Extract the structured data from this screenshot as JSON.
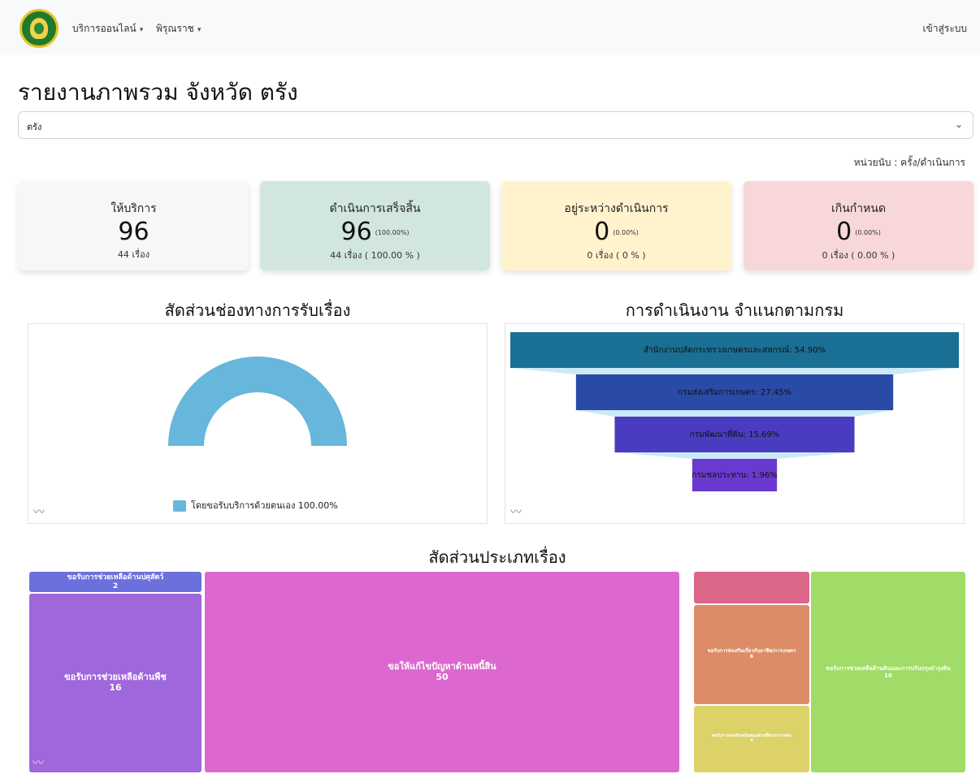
{
  "nav": {
    "online_services": "บริการออนไลน์",
    "consider": "พิรุณราช",
    "login": "เข้าสู่ระบบ"
  },
  "page": {
    "title": "รายงานภาพรวม จังหวัด ตรัง",
    "province_select": "ตรัง",
    "unit": "หน่วยนับ : ครั้ง/ดำเนินการ"
  },
  "cards": {
    "service": {
      "label": "ให้บริการ",
      "value": "96",
      "sub": "44 เรื่อง"
    },
    "done": {
      "label": "ดำเนินการเสร็จสิ้น",
      "value": "96",
      "pct": "(100.00%)",
      "sub": "44 เรื่อง ( 100.00 % )"
    },
    "inprogress": {
      "label": "อยู่ระหว่างดำเนินการ",
      "value": "0",
      "pct": "(0.00%)",
      "sub": "0 เรื่อง ( 0 % )"
    },
    "overdue": {
      "label": "เกินกำหนด",
      "value": "0",
      "pct": "(0.00%)",
      "sub": "0 เรื่อง ( 0.00 % )"
    }
  },
  "sections": {
    "channels": "สัดส่วนช่องทางการรับเรื่อง",
    "departments": "การดำเนินงาน จำแนกตามกรม",
    "types": "สัดส่วนประเภทเรื่อง"
  },
  "colors": {
    "pie": "#67b6dc",
    "funnel_1": "#1a6f94",
    "funnel_2": "#2a4aa8",
    "funnel_3": "#4a3cc0",
    "funnel_4": "#6a3ad0"
  },
  "chart_data": [
    {
      "type": "pie",
      "variant": "semi-donut",
      "title": "สัดส่วนช่องทางการรับเรื่อง",
      "series": [
        {
          "name": "โดยขอรับบริการด้วยตนเอง",
          "value": 100.0,
          "label": "โดยขอรับบริการด้วยตนเอง 100.00%"
        }
      ],
      "legend": "bottom"
    },
    {
      "type": "funnel",
      "title": "การดำเนินงาน จำแนกตามกรม",
      "series": [
        {
          "name": "สำนักงานปลัดกระทรวงเกษตรและสหกรณ์",
          "value": 54.9,
          "label": "สำนักงานปลัดกระทรวงเกษตรและสหกรณ์: 54.90%"
        },
        {
          "name": "กรมส่งเสริมการเกษตร",
          "value": 27.45,
          "label": "กรมส่งเสริมการเกษตร: 27.45%"
        },
        {
          "name": "กรมพัฒนาที่ดิน",
          "value": 15.69,
          "label": "กรมพัฒนาที่ดิน: 15.69%"
        },
        {
          "name": "กรมชลประทาน",
          "value": 1.96,
          "label": "กรมชลประทาน: 1.96%"
        }
      ]
    },
    {
      "type": "treemap",
      "title": "สัดส่วนประเภทเรื่อง",
      "series": [
        {
          "name": "ขอรับการช่วยเหลือด้านปศุสัตว์",
          "value": 2,
          "color": "#6c70dc"
        },
        {
          "name": "ขอรับการช่วยเหลือด้านพืช",
          "value": 16,
          "color": "#a066dc"
        },
        {
          "name": "ขอให้แก้ไขปัญหาด้านหนี้สิน",
          "value": 50,
          "color": "#dc67ce"
        },
        {
          "name": "",
          "value": 3,
          "color": "#dc6788"
        },
        {
          "name": "ขอรับการส่งเสริมเกี่ยวกับอาชีพ/การเกษตร",
          "value": 6,
          "color": "#dc8c67"
        },
        {
          "name": "ขอรับการส่งเสริมสนับสนุนด้านที่ดินการเกษตร",
          "value": 4,
          "color": "#dcd267"
        },
        {
          "name": "ขอรับการช่วยเหลือด้านดินและการปรับปรุงบำรุงดิน",
          "value": 16,
          "color": "#a0dc67"
        }
      ]
    }
  ]
}
